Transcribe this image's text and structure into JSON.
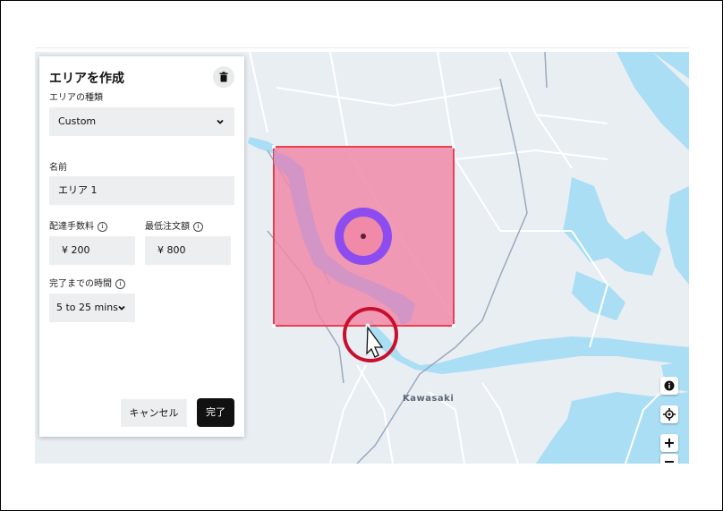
{
  "panel": {
    "title": "エリアを作成",
    "area_type_label": "エリアの種類",
    "area_type_value": "Custom",
    "name_label": "名前",
    "name_value": "エリア 1",
    "delivery_fee_label": "配達手数料",
    "delivery_fee_value": "¥ 200",
    "min_order_label": "最低注文額",
    "min_order_value": "¥ 800",
    "completion_time_label": "完了までの時間",
    "completion_time_value": "5 to 25 mins",
    "cancel_label": "キャンセル",
    "done_label": "完了"
  },
  "map": {
    "place_label": "Kawasaki",
    "area_fill_color": "#f08aa8",
    "area_border_color": "#e8404e",
    "marker_color": "#8d4cf0",
    "highlight_circle_color": "#c8102e",
    "water_color": "#a9def4",
    "controls": [
      "info-icon",
      "locate-icon",
      "zoom-in-icon",
      "zoom-out-icon"
    ]
  }
}
